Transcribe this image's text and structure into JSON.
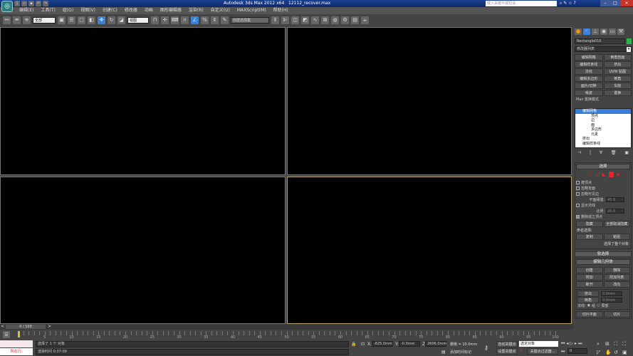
{
  "title_bar": {
    "app": "Autodesk 3ds Max  2012 x64",
    "file": "12112_recover.max",
    "search_placeholder": "键入关键字或短语",
    "min": "–",
    "max": "□",
    "close": "✕"
  },
  "menu": [
    "编辑(E)",
    "工具(T)",
    "组(G)",
    "视图(V)",
    "创建(C)",
    "修改器",
    "动画",
    "图形编辑器",
    "渲染(R)",
    "自定义(U)",
    "MAXScript(M)",
    "帮助(H)"
  ],
  "toolbar": {
    "selection_filter": "全部",
    "ref_coord": "视图",
    "named_selection": "创建选择集"
  },
  "command_panel": {
    "object_name": "Rectangle010",
    "object_color": "#2db34a",
    "modifier_list": "修改器列表",
    "modifier_buttons": [
      "编辑网格",
      "倒角剖面",
      "编辑样条线",
      "挤出",
      "法线",
      "UVW 贴图",
      "编辑多边形",
      "倒角",
      "面片/切换",
      "车削",
      "噪波",
      "置换"
    ],
    "max_mode": "Max 置换模式",
    "stack": [
      {
        "label": "编辑网格",
        "selected": true
      },
      {
        "label": "顶点"
      },
      {
        "label": "边"
      },
      {
        "label": "面"
      },
      {
        "label": "多边形"
      },
      {
        "label": "元素"
      },
      {
        "label": "挤出"
      },
      {
        "label": "编辑样条线"
      }
    ],
    "selection": {
      "title": "选择",
      "by_vertex": "按顶点",
      "ignore_back": "忽略背面",
      "ignore_visible": "忽略可见边",
      "plane_thresh_label": "平面阈值:",
      "plane_thresh": "45.0",
      "show_normals": "显示法线",
      "scale_label": "比例:",
      "scale": "20.0",
      "delete_isolated": "删除孤立顶点",
      "hide": "隐藏",
      "unhide_all": "全部取消隐藏",
      "named_sel": "命名选择:",
      "copy": "复制",
      "paste": "粘贴",
      "info": "选择了整个对象"
    },
    "soft_selection": "软选择",
    "edit_geometry": {
      "title": "编辑几何体",
      "create": "创建",
      "delete": "删除",
      "attach": "附加",
      "attach_list": "附加列表",
      "detach": "断开",
      "turn": "改向",
      "extrude_label": "挤出",
      "extrude": "0.0mm",
      "bevel_label": "倒角",
      "bevel": "0.0mm",
      "normal_label": "法线:",
      "group": "组",
      "local": "局部",
      "slice_plane": "切片平面",
      "slice": "切片"
    }
  },
  "timeline": {
    "frame": "0 / 100",
    "ticks": [
      0,
      5,
      10,
      15,
      20,
      25,
      30,
      35,
      40,
      45,
      50,
      55,
      60,
      65,
      70,
      75,
      80,
      85,
      90,
      95,
      100
    ]
  },
  "status": {
    "script_label": "所在行:",
    "selected": "选择了 1 个 对象",
    "render_time": "渲染时间  0:37:09",
    "x_label": "X:",
    "x": "-825.0mm",
    "y_label": "Y:",
    "y": "-0.0mm",
    "z_label": "Z:",
    "z": "2606.0mm",
    "grid": "栅格 = 10.0mm",
    "add_tag": "添加时间标记",
    "auto_key": "自动关键点",
    "key_mode": "选定对象",
    "set_key": "设置关键点",
    "key_filter": "关键点过滤器...",
    "current_frame": "0"
  }
}
